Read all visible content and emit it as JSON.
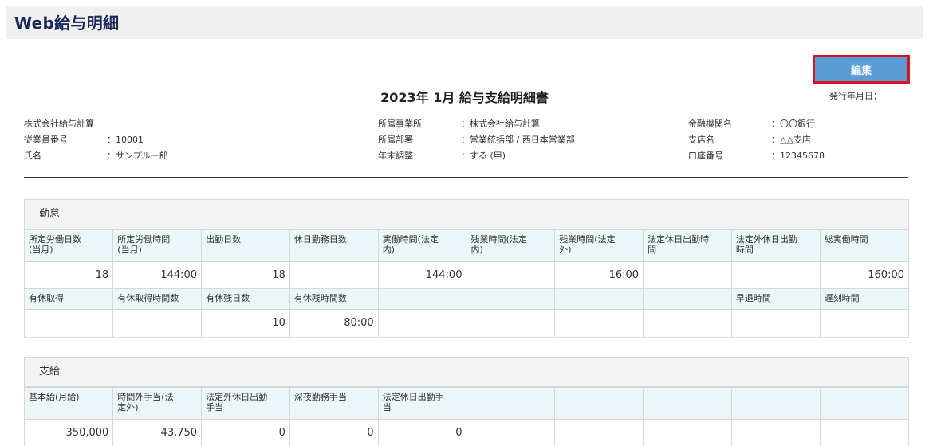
{
  "app": {
    "title": "Web給与明細"
  },
  "toolbar": {
    "edit_label": "編集"
  },
  "document": {
    "title": "2023年 1月 給与支給明細書",
    "issue_date_label": "発行年月日："
  },
  "company": {
    "name": "株式会社給与計算",
    "employee_no_label": "従業員番号",
    "employee_no": "：10001",
    "name_label": "氏名",
    "employee_name": "：サンプル一郎"
  },
  "office": {
    "office_label": "所属事業所",
    "office_value": "：株式会社給与計算",
    "dept_label": "所属部署",
    "dept_value": "：営業統括部 / 西日本営業部",
    "yearend_label": "年末調整",
    "yearend_value": "：する (甲)"
  },
  "bank": {
    "bank_label": "金融機関名",
    "bank_value": "：〇〇銀行",
    "branch_label": "支店名",
    "branch_value": "：△△支店",
    "account_label": "口座番号",
    "account_value": "：12345678"
  },
  "attendance": {
    "title": "勤怠",
    "headers1": [
      "所定労働日数\n(当月)",
      "所定労働時間\n(当月)",
      "出勤日数",
      "休日勤務日数",
      "実働時間(法定\n内)",
      "残業時間(法定\n内)",
      "残業時間(法定\n外)",
      "法定休日出勤時\n間",
      "法定外休日出勤\n時間",
      "総実働時間"
    ],
    "values1": [
      "18",
      "144:00",
      "18",
      "",
      "144:00",
      "",
      "16:00",
      "",
      "",
      "160:00"
    ],
    "headers2": [
      "有休取得",
      "有休取得時間数",
      "有休残日数",
      "有休残時間数",
      "",
      "",
      "",
      "",
      "早退時間",
      "遅刻時間"
    ],
    "values2": [
      "",
      "",
      "10",
      "80:00",
      "",
      "",
      "",
      "",
      "",
      ""
    ]
  },
  "payment": {
    "title": "支給",
    "headers1": [
      "基本給(月給)",
      "時間外手当(法\n定外)",
      "法定外休日出勤\n手当",
      "深夜勤務手当",
      "法定休日出勤手\n当",
      "",
      "",
      "",
      "",
      ""
    ],
    "values1": [
      "350,000",
      "43,750",
      "0",
      "0",
      "0",
      "",
      "",
      "",
      "",
      ""
    ]
  }
}
